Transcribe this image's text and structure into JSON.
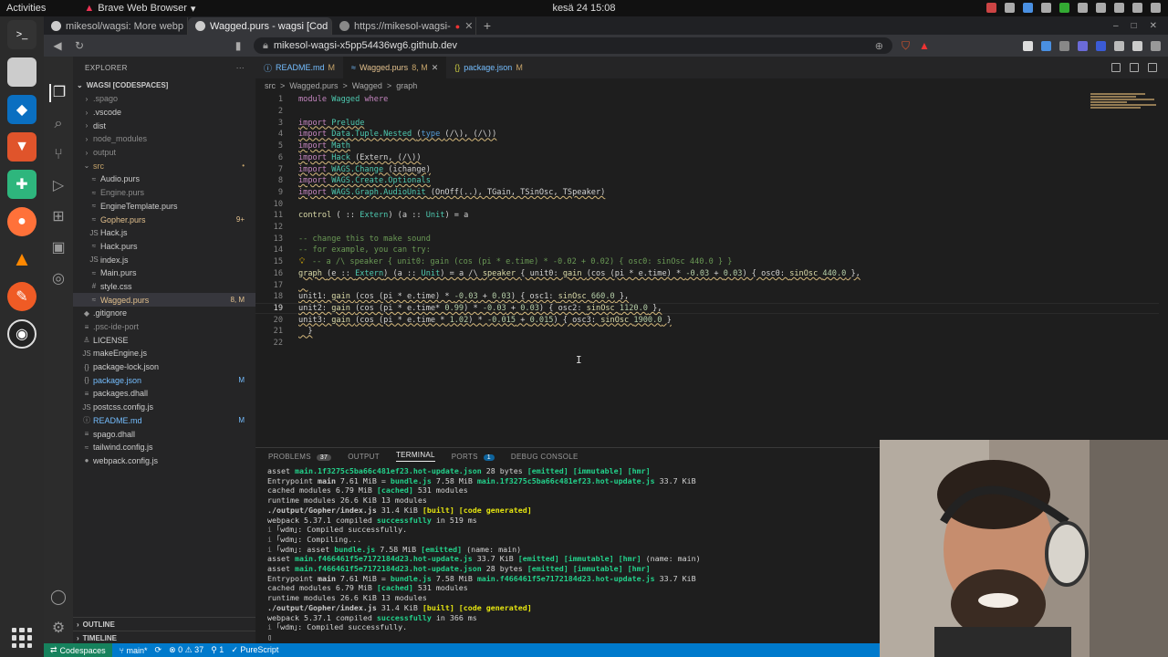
{
  "gnome": {
    "activities": "Activities",
    "app_name": "Brave Web Browser",
    "clock": "kesä 24  15:08"
  },
  "browser": {
    "tabs": [
      {
        "label": "mikesol/wagsi: More webp"
      },
      {
        "label": "Wagged.purs - wagsi [Cod"
      },
      {
        "label": "https://mikesol-wagsi-"
      }
    ],
    "new_tab": "+",
    "url": "mikesol-wagsi-x5pp54436wg6.github.dev"
  },
  "explorer": {
    "title": "EXPLORER",
    "more": "···",
    "root": "WAGSI [CODESPACES]",
    "items": [
      {
        "label": ".spago",
        "ic": "›",
        "indent": 1,
        "color": "#8b8b8b"
      },
      {
        "label": ".vscode",
        "ic": "›",
        "indent": 1,
        "color": "#ccc"
      },
      {
        "label": "dist",
        "ic": "›",
        "indent": 1,
        "color": "#ccc"
      },
      {
        "label": "node_modules",
        "ic": "›",
        "indent": 1,
        "color": "#8b8b8b"
      },
      {
        "label": "output",
        "ic": "›",
        "indent": 1,
        "color": "#8b8b8b"
      },
      {
        "label": "src",
        "ic": "⌄",
        "indent": 1,
        "color": "#c5a36a",
        "badge": "•"
      },
      {
        "label": "Audio.purs",
        "ic": "≈",
        "indent": 2,
        "color": "#ccc"
      },
      {
        "label": "Engine.purs",
        "ic": "≈",
        "indent": 2,
        "color": "#8b8b8b"
      },
      {
        "label": "EngineTemplate.purs",
        "ic": "≈",
        "indent": 2,
        "color": "#ccc"
      },
      {
        "label": "Gopher.purs",
        "ic": "≈",
        "indent": 2,
        "color": "#e2c08d",
        "badge": "9+"
      },
      {
        "label": "Hack.js",
        "ic": "JS",
        "indent": 2,
        "color": "#ccc"
      },
      {
        "label": "Hack.purs",
        "ic": "≈",
        "indent": 2,
        "color": "#ccc"
      },
      {
        "label": "index.js",
        "ic": "JS",
        "indent": 2,
        "color": "#ccc"
      },
      {
        "label": "Main.purs",
        "ic": "≈",
        "indent": 2,
        "color": "#ccc"
      },
      {
        "label": "style.css",
        "ic": "#",
        "indent": 2,
        "color": "#ccc"
      },
      {
        "label": "Wagged.purs",
        "ic": "≈",
        "indent": 2,
        "color": "#e2c08d",
        "badge": "8, M",
        "sel": true
      },
      {
        "label": ".gitignore",
        "ic": "◆",
        "indent": 1,
        "color": "#ccc"
      },
      {
        "label": ".psc-ide-port",
        "ic": "≡",
        "indent": 1,
        "color": "#8b8b8b"
      },
      {
        "label": "LICENSE",
        "ic": "♙",
        "indent": 1,
        "color": "#ccc"
      },
      {
        "label": "makeEngine.js",
        "ic": "JS",
        "indent": 1,
        "color": "#ccc"
      },
      {
        "label": "package-lock.json",
        "ic": "{}",
        "indent": 1,
        "color": "#ccc"
      },
      {
        "label": "package.json",
        "ic": "{}",
        "indent": 1,
        "color": "#75beff",
        "badge": "M"
      },
      {
        "label": "packages.dhall",
        "ic": "≡",
        "indent": 1,
        "color": "#ccc"
      },
      {
        "label": "postcss.config.js",
        "ic": "JS",
        "indent": 1,
        "color": "#ccc"
      },
      {
        "label": "README.md",
        "ic": "ⓘ",
        "indent": 1,
        "color": "#75beff",
        "badge": "M"
      },
      {
        "label": "spago.dhall",
        "ic": "≡",
        "indent": 1,
        "color": "#ccc"
      },
      {
        "label": "tailwind.config.js",
        "ic": "≈",
        "indent": 1,
        "color": "#ccc"
      },
      {
        "label": "webpack.config.js",
        "ic": "●",
        "indent": 1,
        "color": "#ccc"
      }
    ],
    "outline": "OUTLINE",
    "timeline": "TIMELINE"
  },
  "editor_tabs": [
    {
      "label": "README.md",
      "mod": "M",
      "icon": "ⓘ",
      "active": false
    },
    {
      "label": "Wagged.purs",
      "mod": "8, M",
      "icon": "≈",
      "active": true
    },
    {
      "label": "package.json",
      "mod": "M",
      "icon": "{}",
      "active": false
    }
  ],
  "breadcrumbs": [
    "src",
    ">",
    "Wagged.purs",
    ">",
    "Wagged",
    ">",
    "graph"
  ],
  "code": {
    "current_line": 19,
    "lines": [
      [
        [
          "k",
          "module "
        ],
        [
          "m",
          "Wagged"
        ],
        [
          "k",
          " where"
        ]
      ],
      [],
      [
        [
          "k",
          "import "
        ],
        [
          "m",
          "Prelude"
        ]
      ],
      [
        [
          "k",
          "import "
        ],
        [
          "m",
          "Data.Tuple.Nested "
        ],
        [
          "t",
          "("
        ],
        [
          "kw",
          "type "
        ],
        [
          "t",
          "(/\\), (/\\))"
        ]
      ],
      [
        [
          "k",
          "import "
        ],
        [
          "m",
          "Math"
        ]
      ],
      [
        [
          "k",
          "import "
        ],
        [
          "m",
          "Hack "
        ],
        [
          "t",
          "(Extern, (/\\))"
        ]
      ],
      [
        [
          "k",
          "import "
        ],
        [
          "m",
          "WAGS.Change "
        ],
        [
          "t",
          "(ichange)"
        ]
      ],
      [
        [
          "k",
          "import "
        ],
        [
          "m",
          "WAGS.Create.Optionals"
        ]
      ],
      [
        [
          "k",
          "import "
        ],
        [
          "m",
          "WAGS.Graph.AudioUnit "
        ],
        [
          "t",
          "(OnOff(..), TGain, TSinOsc, TSpeaker)"
        ]
      ],
      [],
      [
        [
          "u",
          "control "
        ],
        [
          "t",
          "( :: "
        ],
        [
          "m",
          "Extern"
        ],
        [
          "t",
          ") (a :: "
        ],
        [
          "m",
          "Unit"
        ],
        [
          "t",
          ") = a"
        ]
      ],
      [],
      [
        [
          "c",
          "-- change this to make sound"
        ]
      ],
      [
        [
          "c",
          "-- for example, you can try:"
        ]
      ],
      [
        [
          "c",
          "-- a /\\ speaker { unit0: gain (cos (pi * e.time) * -0.02 + 0.02) { osc0: sinOsc 440.0 } }"
        ]
      ],
      [
        [
          "u",
          "graph "
        ],
        [
          "t",
          "(e :: "
        ],
        [
          "m",
          "Extern"
        ],
        [
          "t",
          ") (a :: "
        ],
        [
          "m",
          "Unit"
        ],
        [
          "t",
          ") = a /\\ "
        ],
        [
          "u",
          "speaker "
        ],
        [
          "t",
          "{ unit0: "
        ],
        [
          "u",
          "gain "
        ],
        [
          "t",
          "(cos (pi * e.time) * "
        ],
        [
          "n",
          "-0.03"
        ],
        [
          "t",
          " + "
        ],
        [
          "n",
          "0.03"
        ],
        [
          "t",
          ") { osc0: "
        ],
        [
          "u",
          "sinOsc "
        ],
        [
          "n",
          "440.0"
        ],
        [
          "t",
          " },"
        ]
      ],
      [
        [
          "t",
          "  "
        ]
      ],
      [
        [
          "t",
          "unit1: "
        ],
        [
          "u",
          "gain "
        ],
        [
          "t",
          "(cos (pi * e.time) * "
        ],
        [
          "n",
          "-0.03"
        ],
        [
          "t",
          " + "
        ],
        [
          "n",
          "0.03"
        ],
        [
          "t",
          ") { osc1: "
        ],
        [
          "u",
          "sinOsc "
        ],
        [
          "n",
          "660.0"
        ],
        [
          "t",
          " },"
        ]
      ],
      [
        [
          "t",
          "unit2: "
        ],
        [
          "u",
          "gain "
        ],
        [
          "t",
          "(cos (pi * e.time* "
        ],
        [
          "n",
          "0.99"
        ],
        [
          "t",
          ") * "
        ],
        [
          "n",
          "-0.03"
        ],
        [
          "t",
          " + "
        ],
        [
          "n",
          "0.03"
        ],
        [
          "t",
          ") { osc2: "
        ],
        [
          "u",
          "sinOsc "
        ],
        [
          "n",
          "1120.0"
        ],
        [
          "t",
          " },"
        ]
      ],
      [
        [
          "t",
          "unit3: "
        ],
        [
          "u",
          "gain "
        ],
        [
          "t",
          "(cos (pi * e.time * "
        ],
        [
          "n",
          "1.02"
        ],
        [
          "t",
          ") * "
        ],
        [
          "n",
          "-0.015"
        ],
        [
          "t",
          " + "
        ],
        [
          "n",
          "0.015"
        ],
        [
          "t",
          ") { osc3: "
        ],
        [
          "u",
          "sinOsc "
        ],
        [
          "n",
          "1900.0"
        ],
        [
          "t",
          " }"
        ]
      ],
      [
        [
          "t",
          "  }"
        ]
      ],
      []
    ]
  },
  "panel": {
    "tabs": [
      {
        "label": "PROBLEMS",
        "count": "37"
      },
      {
        "label": "OUTPUT"
      },
      {
        "label": "TERMINAL",
        "active": true
      },
      {
        "label": "PORTS",
        "count": "1"
      },
      {
        "label": "DEBUG CONSOLE"
      }
    ],
    "terminal": [
      [
        [
          "t",
          "asset "
        ],
        [
          "g b",
          "main.1f3275c5ba66c481ef23.hot-update.json"
        ],
        [
          "t",
          " 28 bytes "
        ],
        [
          "g b",
          "[emitted] [immutable] [hmr]"
        ]
      ],
      [
        [
          "t",
          "Entrypoint "
        ],
        [
          "b",
          "main"
        ],
        [
          "t",
          " 7.61 MiB = "
        ],
        [
          "g b",
          "bundle.js"
        ],
        [
          "t",
          " 7.58 MiB "
        ],
        [
          "g b",
          "main.1f3275c5ba66c481ef23.hot-update.js"
        ],
        [
          "t",
          " 33.7 KiB"
        ]
      ],
      [
        [
          "t",
          "cached modules 6.79 MiB "
        ],
        [
          "g b",
          "[cached]"
        ],
        [
          "t",
          " 531 modules"
        ]
      ],
      [
        [
          "t",
          "runtime modules 26.6 KiB 13 modules"
        ]
      ],
      [
        [
          "b",
          "./output/Gopher/index.js"
        ],
        [
          "t",
          " 31.4 KiB "
        ],
        [
          "y b",
          "[built] [code generated]"
        ]
      ],
      [
        [
          "t",
          "webpack 5.37.1 compiled "
        ],
        [
          "g b",
          "successfully"
        ],
        [
          "t",
          " in 519 ms"
        ]
      ],
      [
        [
          "d",
          "i "
        ],
        [
          "t",
          "｢wdm｣: Compiled successfully."
        ]
      ],
      [
        [
          "d",
          "i "
        ],
        [
          "t",
          "｢wdm｣: Compiling..."
        ]
      ],
      [
        [
          "d",
          "i "
        ],
        [
          "t",
          "｢wdm｣: asset "
        ],
        [
          "g b",
          "bundle.js"
        ],
        [
          "t",
          " 7.58 MiB "
        ],
        [
          "g b",
          "[emitted]"
        ],
        [
          "t",
          " (name: main)"
        ]
      ],
      [
        [
          "t",
          "asset "
        ],
        [
          "g b",
          "main.f466461f5e7172184d23.hot-update.js"
        ],
        [
          "t",
          " 33.7 KiB "
        ],
        [
          "g b",
          "[emitted] [immutable] [hmr]"
        ],
        [
          "t",
          " (name: main)"
        ]
      ],
      [
        [
          "t",
          "asset "
        ],
        [
          "g b",
          "main.f466461f5e7172184d23.hot-update.json"
        ],
        [
          "t",
          " 28 bytes "
        ],
        [
          "g b",
          "[emitted] [immutable] [hmr]"
        ]
      ],
      [
        [
          "t",
          "Entrypoint "
        ],
        [
          "b",
          "main"
        ],
        [
          "t",
          " 7.61 MiB = "
        ],
        [
          "g b",
          "bundle.js"
        ],
        [
          "t",
          " 7.58 MiB "
        ],
        [
          "g b",
          "main.f466461f5e7172184d23.hot-update.js"
        ],
        [
          "t",
          " 33.7 KiB"
        ]
      ],
      [
        [
          "t",
          "cached modules 6.79 MiB "
        ],
        [
          "g b",
          "[cached]"
        ],
        [
          "t",
          " 531 modules"
        ]
      ],
      [
        [
          "t",
          "runtime modules 26.6 KiB 13 modules"
        ]
      ],
      [
        [
          "b",
          "./output/Gopher/index.js"
        ],
        [
          "t",
          " 31.4 KiB "
        ],
        [
          "y b",
          "[built] [code generated]"
        ]
      ],
      [
        [
          "t",
          "webpack 5.37.1 compiled "
        ],
        [
          "g b",
          "successfully"
        ],
        [
          "t",
          " in 366 ms"
        ]
      ],
      [
        [
          "d",
          "i "
        ],
        [
          "t",
          "｢wdm｣: Compiled successfully."
        ]
      ],
      [
        [
          "t",
          "▯"
        ]
      ]
    ]
  },
  "statusbar": {
    "remote": "Codespaces",
    "branch": "main*",
    "sync": "⟳",
    "problems": "⊗ 0 ⚠ 37",
    "ports": "⚲ 1",
    "lang": "PureScript"
  }
}
